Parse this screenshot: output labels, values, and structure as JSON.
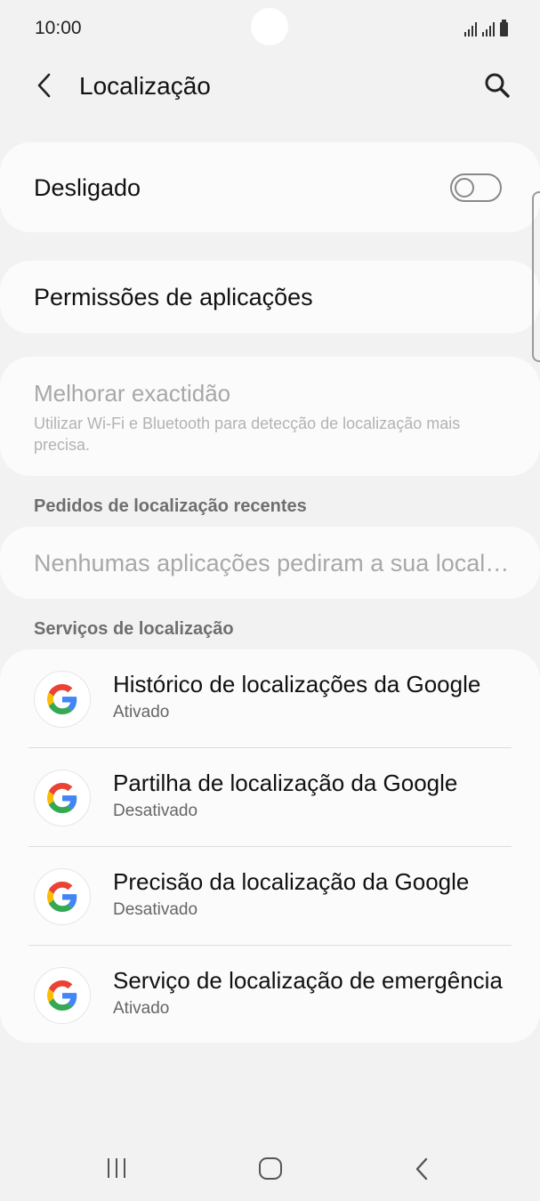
{
  "status_bar": {
    "time": "10:00"
  },
  "app_bar": {
    "title": "Localização",
    "back_icon": "chevron-left-icon",
    "search_icon": "search-icon"
  },
  "master_switch": {
    "label": "Desligado",
    "state": "off"
  },
  "app_permissions": {
    "label": "Permissões de aplicações"
  },
  "improve_accuracy": {
    "title": "Melhorar exactidão",
    "subtitle": "Utilizar Wi-Fi e Bluetooth para detecção de localização mais precisa."
  },
  "recent_requests": {
    "header": "Pedidos de localização recentes",
    "empty_text": "Nenhumas aplicações pediram a sua localização recentemente"
  },
  "location_services": {
    "header": "Serviços de localização",
    "items": [
      {
        "title": "Histórico de localizações da Google",
        "status": "Ativado",
        "icon": "google-icon"
      },
      {
        "title": "Partilha de localização da Google",
        "status": "Desativado",
        "icon": "google-icon"
      },
      {
        "title": "Precisão da localização da Google",
        "status": "Desativado",
        "icon": "google-icon"
      },
      {
        "title": "Serviço de localização de emergência",
        "status": "Ativado",
        "icon": "google-icon"
      }
    ]
  },
  "colors": {
    "background": "#f2f2f2",
    "card": "#fbfbfb",
    "disabled_text": "#a8a8a8",
    "google_blue": "#4285F4",
    "google_red": "#EA4335",
    "google_yellow": "#FBBC05",
    "google_green": "#34A853"
  }
}
